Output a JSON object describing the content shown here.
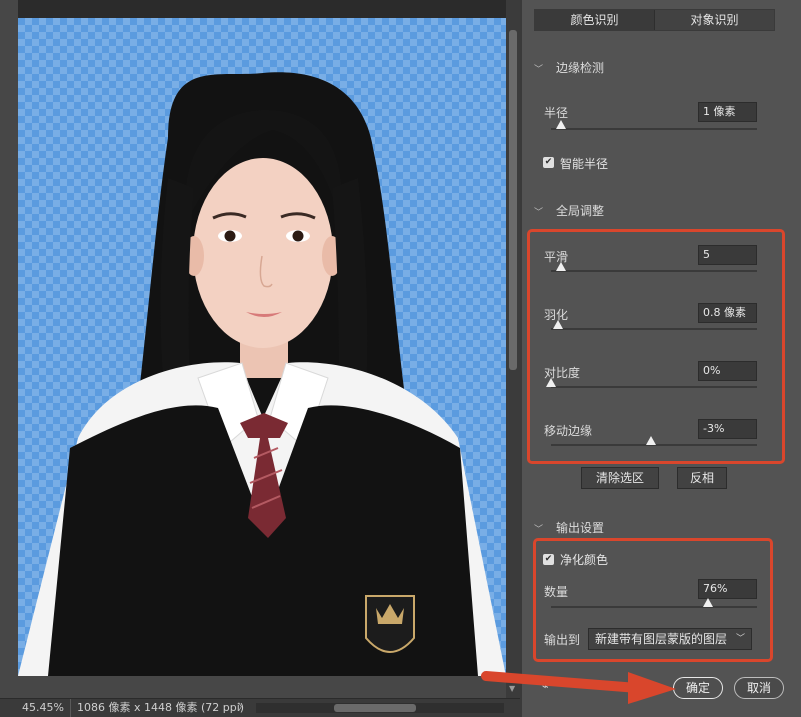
{
  "status": {
    "zoom": "45.45%",
    "info": "1086 像素 x 1448 像素 (72 ppi)",
    "more_arrow": "〉"
  },
  "tabs": [
    {
      "label": "颜色识别",
      "active": true
    },
    {
      "label": "对象识别",
      "active": false
    }
  ],
  "edge_detection": {
    "header": "边缘检测",
    "radius_label": "半径",
    "radius_value": "1 像素",
    "radius_slider": 0.02,
    "smart_radius_label": "智能半径",
    "smart_radius_checked": true
  },
  "global_adjust": {
    "header": "全局调整",
    "smooth_label": "平滑",
    "smooth_value": "5",
    "smooth_slider": 0.05,
    "feather_label": "羽化",
    "feather_value": "0.8 像素",
    "feather_slider": 0.02,
    "contrast_label": "对比度",
    "contrast_value": "0%",
    "contrast_slider": 0.0,
    "shift_edge_label": "移动边缘",
    "shift_edge_value": "-3%",
    "shift_edge_slider": 0.485
  },
  "actions": {
    "clear_selection": "清除选区",
    "invert": "反相"
  },
  "output": {
    "header": "输出设置",
    "decontaminate_label": "净化颜色",
    "decontaminate_checked": true,
    "amount_label": "数量",
    "amount_value": "76%",
    "amount_slider": 0.76,
    "output_to_label": "输出到",
    "output_to_value": "新建带有图层蒙版的图层"
  },
  "footer": {
    "ok": "确定",
    "cancel": "取消"
  },
  "colors": {
    "highlight": "#d9462c",
    "checker_blue": "#5b9bdf",
    "checker_light": "#79aee6",
    "panel_bg": "#535353"
  }
}
